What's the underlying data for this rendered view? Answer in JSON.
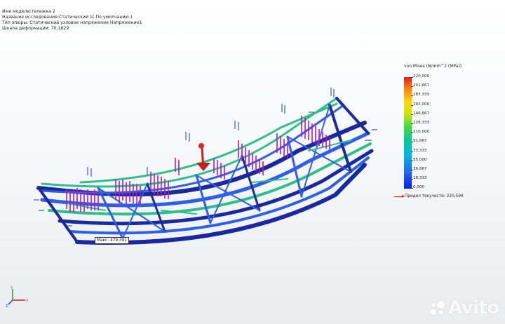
{
  "header": {
    "model_name": "Имя модели:тележка 2",
    "study_name": "Название исследования:Статический 1(-По умолчанию-)",
    "plot_type": "Тип эпюры: Статический узловое напряжение Напряжение1",
    "deformation_scale": "Шкала деформации: 70,1829"
  },
  "legend": {
    "title": "von Mises (N/mm^2 (MPa))",
    "ticks": [
      "220,000",
      "201,667",
      "183,333",
      "165,000",
      "146,667",
      "128,333",
      "110,000",
      "91,667",
      "73,333",
      "55,000",
      "36,667",
      "18,333",
      "0,000"
    ],
    "yield_label": "Предел текучести: 220,594",
    "colors": {
      "max": "#e51d1d",
      "mid": "#3ddc3d",
      "min": "#0a1ef0",
      "yield_arrow": "#d11111"
    }
  },
  "model": {
    "max_label": "Макс: 479,391",
    "frame_colors": {
      "beam_dark": "#1a2a9e",
      "beam_blue": "#2f5fe8",
      "beam_green": "#2fc08a",
      "load_arrow": "#b31ab3",
      "fixture": "#1e3cb4"
    }
  },
  "triad": {
    "x_label": "X",
    "y_label": "Y",
    "z_label": "Z",
    "icons": [
      "axis-triad-icon"
    ]
  },
  "watermark": {
    "text": "Avito",
    "icon": "avito-logo-icon"
  }
}
